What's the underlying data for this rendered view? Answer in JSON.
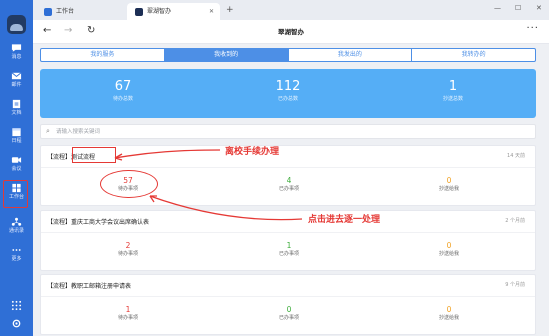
{
  "rail": {
    "items": [
      {
        "label": "消息",
        "icon": "chat-icon"
      },
      {
        "label": "邮件",
        "icon": "mail-icon"
      },
      {
        "label": "文档",
        "icon": "doc-icon"
      },
      {
        "label": "日程",
        "icon": "calendar-icon"
      },
      {
        "label": "会议",
        "icon": "meeting-icon"
      },
      {
        "label": "工作台",
        "icon": "workbench-icon"
      },
      {
        "label": "通讯录",
        "icon": "contacts-icon"
      },
      {
        "label": "更多",
        "icon": "more-icon"
      }
    ]
  },
  "tabs": [
    {
      "label": "工作台"
    },
    {
      "label": "翠湖智办"
    }
  ],
  "nav": {
    "title": "翠湖智办"
  },
  "segments": [
    "我的服务",
    "我收到的",
    "我发出的",
    "我转办的"
  ],
  "stats": [
    {
      "value": "67",
      "label": "待办总数"
    },
    {
      "value": "112",
      "label": "已办总数"
    },
    {
      "value": "1",
      "label": "抄送总数"
    }
  ],
  "search": {
    "placeholder": "请输入搜索关键词"
  },
  "cards": [
    {
      "title": "【流程】测试流程",
      "date": "14 天前",
      "pending": "57",
      "done": "4",
      "cc": "0"
    },
    {
      "title": "【流程】重庆工商大学会议出席确认表",
      "date": "2 个月前",
      "pending": "2",
      "done": "1",
      "cc": "0"
    },
    {
      "title": "【流程】教职工邮箱注册申请表",
      "date": "9 个月前",
      "pending": "1",
      "done": "0",
      "cc": "0"
    }
  ],
  "metric_labels": {
    "pending": "待办事项",
    "done": "已办事项",
    "cc": "抄送给我"
  },
  "annotations": {
    "leave": "离校手续办理",
    "process": "点击进去逐一处理"
  },
  "colors": {
    "accent": "#4d8fe6",
    "rail": "#2f6fd6",
    "stats": "#55aef6",
    "annotation": "#e53935"
  }
}
